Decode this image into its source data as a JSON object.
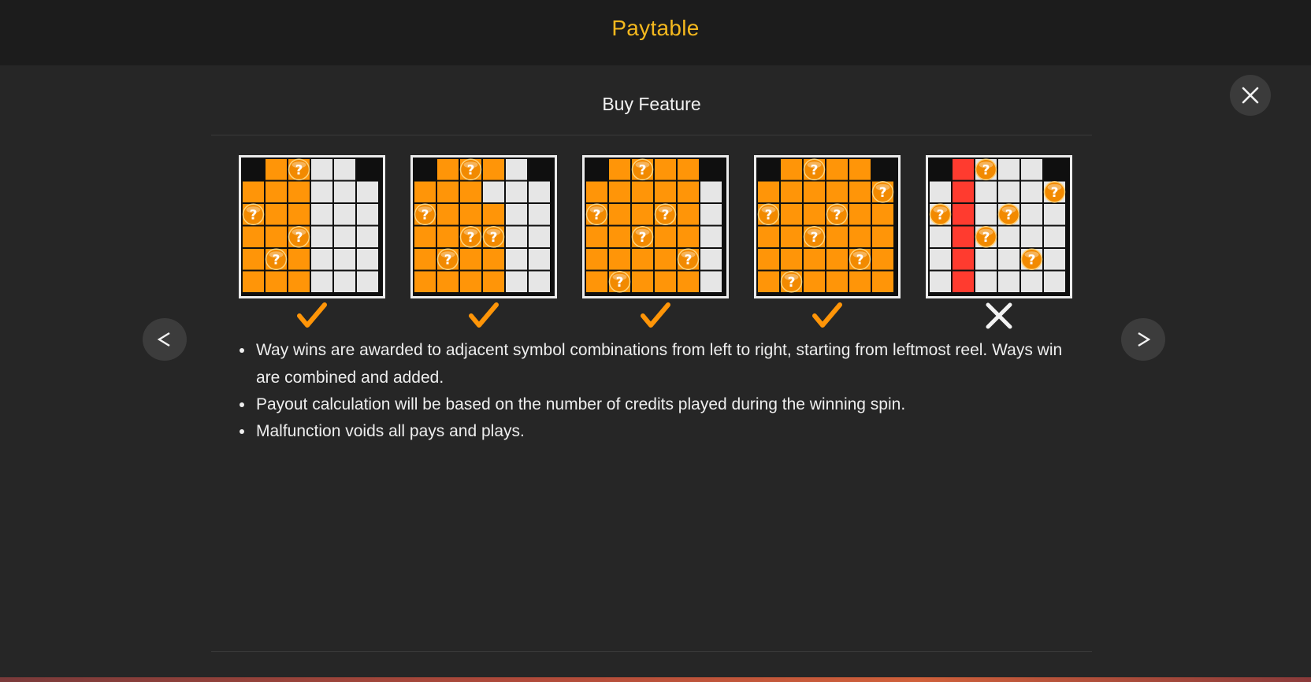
{
  "header": {
    "title": "Paytable"
  },
  "section": {
    "title": "Buy Feature"
  },
  "controls": {
    "close_icon": "close-icon",
    "prev_icon": "chevron-left-icon",
    "next_icon": "chevron-right-icon"
  },
  "colors": {
    "title": "#f4b81e",
    "orange": "#ff9508",
    "grey": "#e6e6e6",
    "red": "#ff3b2f",
    "check": "#ff9508",
    "cross": "#f2f2f2"
  },
  "examples": [
    {
      "result": "win",
      "rows": [
        "KOOLLK",
        "OOOLLL",
        "OOOLLL",
        "OOOLLL",
        "OOOLLL",
        "OOOLLL"
      ],
      "scatters": [
        [
          0,
          2
        ],
        [
          2,
          0
        ],
        [
          3,
          2
        ],
        [
          4,
          1
        ]
      ]
    },
    {
      "result": "win",
      "rows": [
        "KOOOLK",
        "OOOLLL",
        "OOOOLL",
        "OOOOLL",
        "OOOOLL",
        "OOOOLL"
      ],
      "scatters": [
        [
          0,
          2
        ],
        [
          2,
          0
        ],
        [
          3,
          2
        ],
        [
          3,
          3
        ],
        [
          4,
          1
        ]
      ]
    },
    {
      "result": "win",
      "rows": [
        "KOOOOK",
        "OOOOOL",
        "OOOOOL",
        "OOOOOL",
        "OOOOOL",
        "OOOOOL"
      ],
      "scatters": [
        [
          0,
          2
        ],
        [
          2,
          0
        ],
        [
          3,
          2
        ],
        [
          2,
          3
        ],
        [
          4,
          4
        ],
        [
          5,
          1
        ]
      ]
    },
    {
      "result": "win",
      "rows": [
        "KOOOOK",
        "OOOOOO",
        "OOOOOO",
        "OOOOOO",
        "OOOOOO",
        "OOOOOO"
      ],
      "scatters": [
        [
          0,
          2
        ],
        [
          1,
          5
        ],
        [
          2,
          0
        ],
        [
          3,
          2
        ],
        [
          2,
          3
        ],
        [
          4,
          4
        ],
        [
          5,
          1
        ]
      ]
    },
    {
      "result": "no-win",
      "rows": [
        "KRLLLK",
        "LRLLLL",
        "LRLLLL",
        "LRLLLL",
        "LRLLLL",
        "LRLLLL"
      ],
      "scatters": [
        [
          0,
          2
        ],
        [
          1,
          5
        ],
        [
          2,
          0
        ],
        [
          3,
          2
        ],
        [
          2,
          3
        ],
        [
          4,
          4
        ]
      ]
    }
  ],
  "rules": [
    "Way wins are awarded to adjacent symbol combinations from left to right, starting from leftmost reel. Ways win are combined and added.",
    "Payout calculation will be based on the number of credits played during the winning spin.",
    "Malfunction voids all pays and plays."
  ]
}
